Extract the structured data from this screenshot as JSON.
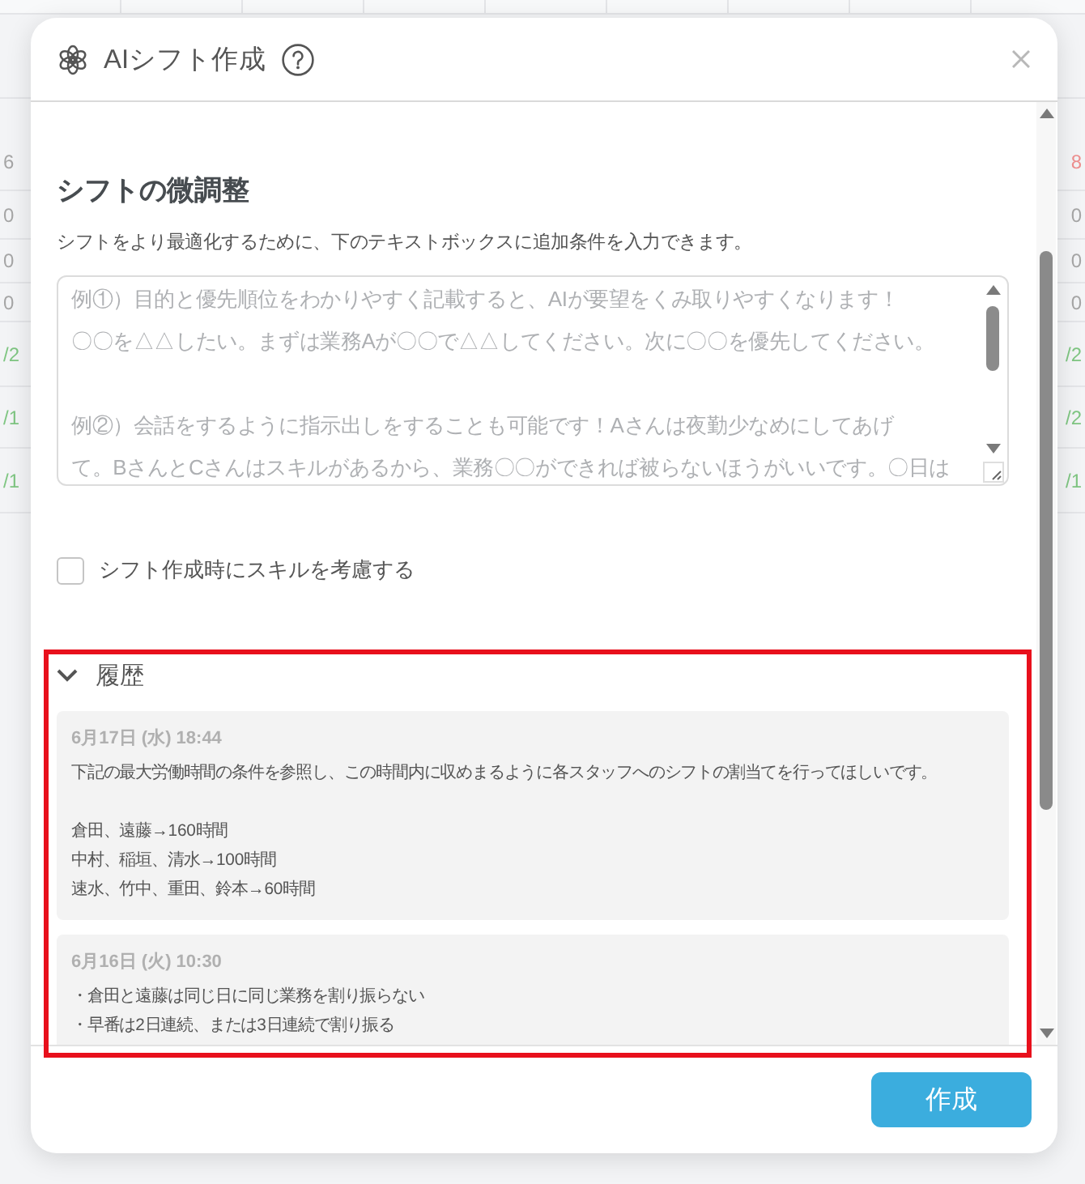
{
  "background": {
    "rows": [
      {
        "left": {
          "text": "6",
          "color": "#a6a6a6"
        },
        "right": {
          "text": "8",
          "color": "#ee8f8f"
        }
      },
      {
        "left": {
          "text": "0",
          "color": "#a6a6a6"
        },
        "right": {
          "text": "0",
          "color": "#a6a6a6"
        }
      },
      {
        "left": {
          "text": "0",
          "color": "#a6a6a6"
        },
        "right": {
          "text": "0",
          "color": "#a6a6a6"
        }
      },
      {
        "left": {
          "text": "0",
          "color": "#a6a6a6"
        },
        "right": {
          "text": "0",
          "color": "#a6a6a6"
        }
      },
      {
        "left": {
          "text": "/2",
          "color": "#7fc682"
        },
        "right": {
          "text": "/2",
          "color": "#7fc682"
        }
      },
      {
        "left": {
          "text": "/1",
          "color": "#7fc682"
        },
        "right": {
          "text": "/2",
          "color": "#7fc682"
        }
      },
      {
        "left": {
          "text": "/1",
          "color": "#7fc682"
        },
        "right": {
          "text": "/1",
          "color": "#7fc682"
        }
      }
    ]
  },
  "dialog": {
    "title": "AIシフト作成",
    "section_title": "シフトの微調整",
    "description": "シフトをより最適化するために、下のテキストボックスに追加条件を入力できます。",
    "prompt_field": {
      "placeholder": [
        [
          "例①）目的と優先順位をわかりやすく記載すると、AIが要望をくみ取りやすくなります！",
          "〇〇を△△したい。まずは業務Aが〇〇で△△してください。次に〇〇を優先してください。"
        ],
        [
          "例②）会話をするように指示出しをすることも可能です！Aさんは夜勤少なめにしてあげ",
          "て。BさんとCさんはスキルがあるから、業務〇〇ができれば被らないほうがいいです。〇日は"
        ]
      ]
    },
    "skill_option": {
      "label": "シフト作成時にスキルを考慮する",
      "checked": false
    },
    "history": {
      "title": "履歴",
      "expanded": true,
      "highlighted": true,
      "entries": [
        {
          "timestamp": "6月17日 (水) 18:44",
          "paragraphs": [
            [
              "下記の最大労働時間の条件を参照し、この時間内に収めまるように各スタッフへのシフトの割当てを行ってほしいです。"
            ],
            [
              "倉田、遠藤→160時間",
              "中村、稲垣、清水→100時間",
              "速水、竹中、重田、鈴本→60時間"
            ]
          ]
        },
        {
          "timestamp": "6月16日 (火) 10:30",
          "paragraphs": [
            [
              "・倉田と遠藤は同じ日に同じ業務を割り振らない",
              "・早番は2日連続、または3日連続で割り振る"
            ]
          ]
        }
      ]
    },
    "create_button": "作成"
  }
}
